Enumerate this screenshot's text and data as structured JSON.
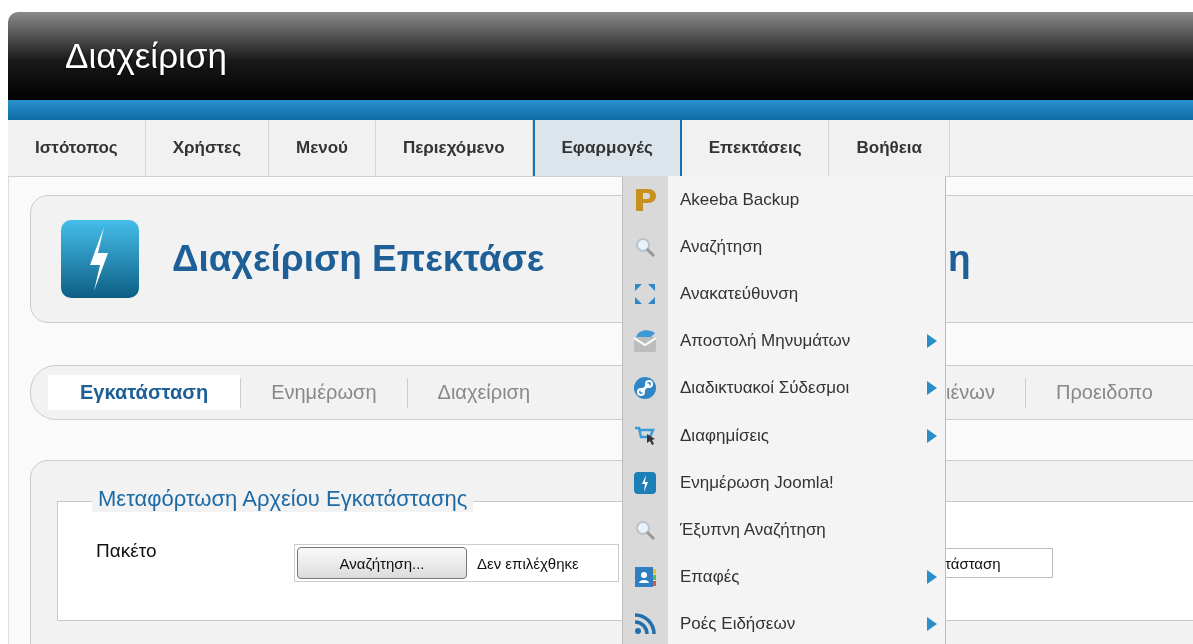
{
  "header": {
    "title": "Διαχείριση"
  },
  "nav": [
    {
      "label": "Ιστότοπος",
      "selected": false
    },
    {
      "label": "Χρήστες",
      "selected": false
    },
    {
      "label": "Μενού",
      "selected": false
    },
    {
      "label": "Περιεχόμενο",
      "selected": false
    },
    {
      "label": "Εφαρμογές",
      "selected": true
    },
    {
      "label": "Επεκτάσεις",
      "selected": false
    },
    {
      "label": "Βοήθεια",
      "selected": false
    }
  ],
  "page_title": {
    "visible_start": "Διαχείριση Επεκτάσε",
    "visible_end": "η"
  },
  "subtabs": [
    {
      "label": "Εγκατάσταση",
      "selected": true
    },
    {
      "label": "Ενημέρωση",
      "selected": false
    },
    {
      "label": "Διαχείριση",
      "selected": false
    },
    {
      "label": "ιένων",
      "selected": false
    },
    {
      "label": "Προειδοπο",
      "selected": false
    }
  ],
  "upload": {
    "legend": "Μεταφόρτωση Αρχείου Εγκατάστασης",
    "label": "Πακέτο",
    "browse_button": "Αναζήτηση...",
    "file_status": "Δεν επιλέχθηκε",
    "field_value": "τάσταση"
  },
  "dropdown": [
    {
      "label": "Akeeba Backup",
      "submenu": false
    },
    {
      "label": "Αναζήτηση",
      "submenu": false
    },
    {
      "label": "Ανακατεύθυνση",
      "submenu": false
    },
    {
      "label": "Αποστολή Μηνυμάτων",
      "submenu": true
    },
    {
      "label": "Διαδικτυακοί Σύδεσμοι",
      "submenu": true
    },
    {
      "label": "Διαφημίσεις",
      "submenu": true
    },
    {
      "label": "Ενημέρωση Joomla!",
      "submenu": false
    },
    {
      "label": "Έξυπνη Αναζήτηση",
      "submenu": false
    },
    {
      "label": "Επαφές",
      "submenu": true
    },
    {
      "label": "Ροές Ειδήσεων",
      "submenu": true
    }
  ]
}
